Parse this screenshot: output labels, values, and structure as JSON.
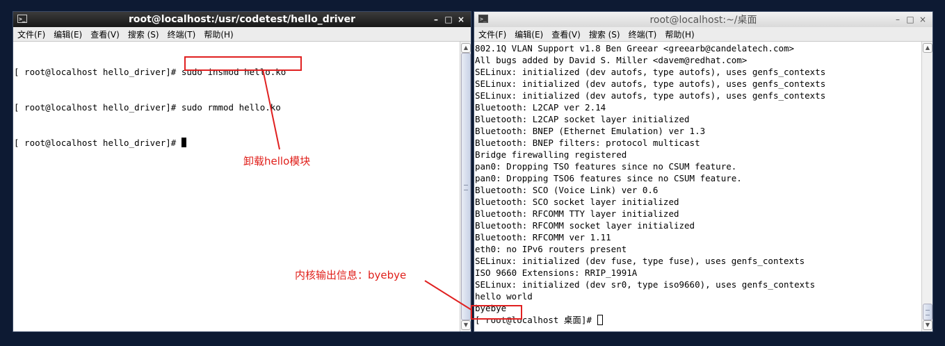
{
  "left_window": {
    "title": "root@localhost:/usr/codetest/hello_driver",
    "controls": {
      "minimize": "–",
      "maximize": "□",
      "close": "×"
    },
    "menu": [
      "文件(F)",
      "编辑(E)",
      "查看(V)",
      "搜索 (S)",
      "终端(T)",
      "帮助(H)"
    ],
    "lines": [
      "[ root@localhost hello_driver]# sudo insmod hello.ko",
      "[ root@localhost hello_driver]# sudo rmmod hello.ko",
      "[ root@localhost hello_driver]# "
    ]
  },
  "right_window": {
    "title": "root@localhost:~/桌面",
    "controls": {
      "minimize": "–",
      "maximize": "□",
      "close": "×"
    },
    "menu": [
      "文件(F)",
      "编辑(E)",
      "查看(V)",
      "搜索 (S)",
      "终端(T)",
      "帮助(H)"
    ],
    "lines": [
      "802.1Q VLAN Support v1.8 Ben Greear <greearb@candelatech.com>",
      "All bugs added by David S. Miller <davem@redhat.com>",
      "SELinux: initialized (dev autofs, type autofs), uses genfs_contexts",
      "SELinux: initialized (dev autofs, type autofs), uses genfs_contexts",
      "SELinux: initialized (dev autofs, type autofs), uses genfs_contexts",
      "Bluetooth: L2CAP ver 2.14",
      "Bluetooth: L2CAP socket layer initialized",
      "Bluetooth: BNEP (Ethernet Emulation) ver 1.3",
      "Bluetooth: BNEP filters: protocol multicast",
      "Bridge firewalling registered",
      "pan0: Dropping TSO features since no CSUM feature.",
      "pan0: Dropping TSO6 features since no CSUM feature.",
      "Bluetooth: SCO (Voice Link) ver 0.6",
      "Bluetooth: SCO socket layer initialized",
      "Bluetooth: RFCOMM TTY layer initialized",
      "Bluetooth: RFCOMM socket layer initialized",
      "Bluetooth: RFCOMM ver 1.11",
      "eth0: no IPv6 routers present",
      "SELinux: initialized (dev fuse, type fuse), uses genfs_contexts",
      "ISO 9660 Extensions: RRIP_1991A",
      "SELinux: initialized (dev sr0, type iso9660), uses genfs_contexts",
      "hello world",
      "byebye",
      "[ root@localhost 桌面]# "
    ]
  },
  "annotations": {
    "rmmod_note": "卸载hello模块",
    "byebye_note": "内核输出信息：byebye"
  },
  "colors": {
    "annotation": "#e02020",
    "desktop": "#0d1a33"
  }
}
